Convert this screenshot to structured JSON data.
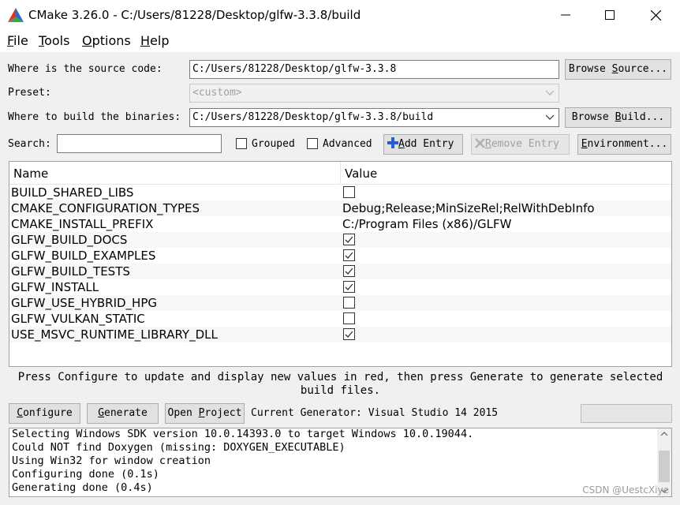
{
  "window": {
    "title": "CMake 3.26.0 - C:/Users/81228/Desktop/glfw-3.3.8/build"
  },
  "menu": [
    {
      "key": "F",
      "rest": "ile"
    },
    {
      "key": "T",
      "rest": "ools"
    },
    {
      "key": "O",
      "rest": "ptions"
    },
    {
      "key": "H",
      "rest": "elp"
    }
  ],
  "source": {
    "label": "Where is the source code:",
    "value": "C:/Users/81228/Desktop/glfw-3.3.8",
    "browse_pre": "Browse ",
    "browse_key": "S",
    "browse_post": "ource..."
  },
  "preset": {
    "label": "Preset:",
    "value": "<custom>"
  },
  "build": {
    "label": "Where to build the binaries:",
    "value": "C:/Users/81228/Desktop/glfw-3.3.8/build",
    "browse_pre": "Browse ",
    "browse_key": "B",
    "browse_post": "uild..."
  },
  "search": {
    "label": "Search:",
    "value": "",
    "grouped_label": "Grouped",
    "grouped_checked": false,
    "advanced_label": "Advanced",
    "advanced_checked": false,
    "add_key": "A",
    "add_rest": "dd Entry",
    "remove_key": "R",
    "remove_rest": "emove Entry",
    "env_key": "E",
    "env_rest": "nvironment..."
  },
  "table": {
    "headers": {
      "name": "Name",
      "value": "Value"
    },
    "rows": [
      {
        "name": "BUILD_SHARED_LIBS",
        "type": "bool",
        "checked": false
      },
      {
        "name": "CMAKE_CONFIGURATION_TYPES",
        "type": "text",
        "value": "Debug;Release;MinSizeRel;RelWithDebInfo"
      },
      {
        "name": "CMAKE_INSTALL_PREFIX",
        "type": "text",
        "value": "C:/Program Files (x86)/GLFW"
      },
      {
        "name": "GLFW_BUILD_DOCS",
        "type": "bool",
        "checked": true
      },
      {
        "name": "GLFW_BUILD_EXAMPLES",
        "type": "bool",
        "checked": true
      },
      {
        "name": "GLFW_BUILD_TESTS",
        "type": "bool",
        "checked": true
      },
      {
        "name": "GLFW_INSTALL",
        "type": "bool",
        "checked": true
      },
      {
        "name": "GLFW_USE_HYBRID_HPG",
        "type": "bool",
        "checked": false
      },
      {
        "name": "GLFW_VULKAN_STATIC",
        "type": "bool",
        "checked": false
      },
      {
        "name": "USE_MSVC_RUNTIME_LIBRARY_DLL",
        "type": "bool",
        "checked": true
      }
    ]
  },
  "hint": "Press Configure to update and display new values in red, then press Generate to generate selected build files.",
  "actions": {
    "configure_key": "C",
    "configure_rest": "onfigure",
    "generate_key": "G",
    "generate_rest": "enerate",
    "open_pre": "Open ",
    "open_key": "P",
    "open_rest": "roject",
    "generator": "Current Generator: Visual Studio 14 2015"
  },
  "output": [
    "Selecting Windows SDK version 10.0.14393.0 to target Windows 10.0.19044.",
    "Could NOT find Doxygen (missing: DOXYGEN_EXECUTABLE)",
    "Using Win32 for window creation",
    "Configuring done (0.1s)",
    "Generating done (0.4s)"
  ],
  "watermark": "CSDN @UestcXiye",
  "icons": {
    "app": "cmake-triangle-icon",
    "add": "plus-icon",
    "remove": "x-icon",
    "check": "checkmark-icon"
  },
  "colors": {
    "app_red": "#e0342b",
    "app_blue": "#2f6ac6",
    "app_green": "#3aa64a",
    "add_icon": "#2a5bd7"
  }
}
